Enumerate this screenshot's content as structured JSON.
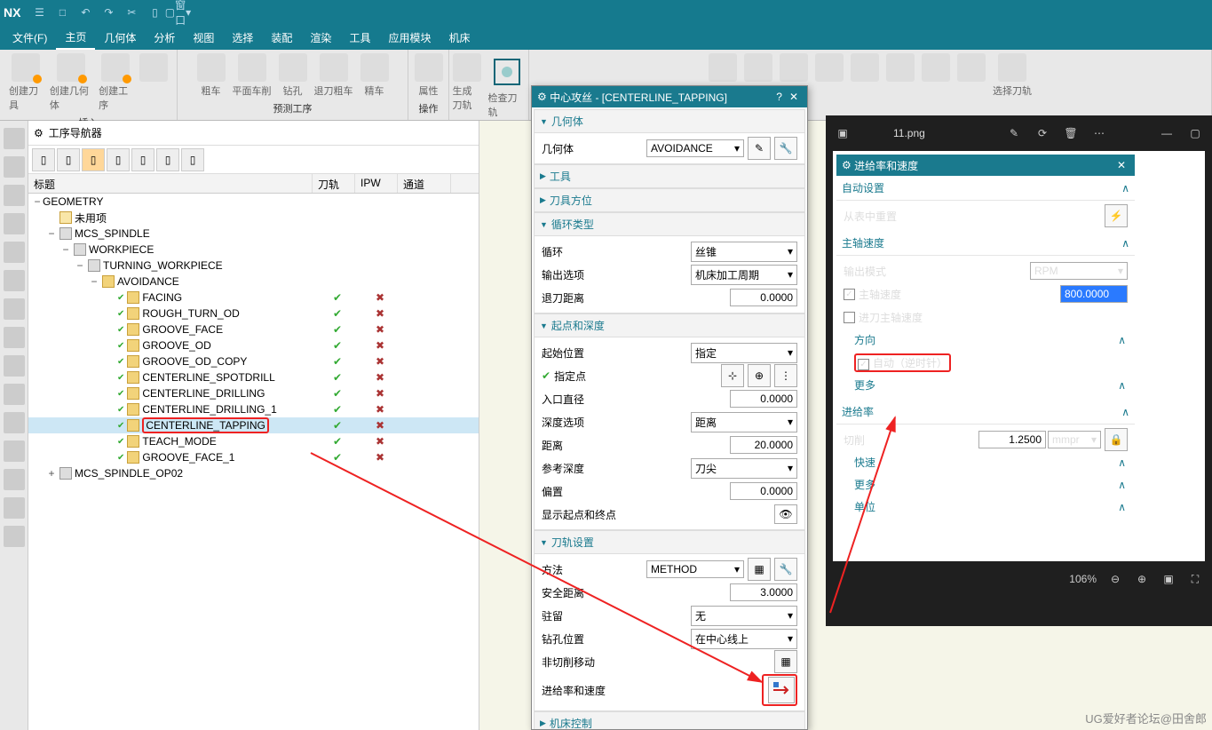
{
  "app": {
    "logo": "NX",
    "window_dropdown": "窗口"
  },
  "menus": {
    "file": "文件(F)",
    "home": "主页",
    "geom": "几何体",
    "analyze": "分析",
    "view": "视图",
    "select": "选择",
    "assemble": "装配",
    "render": "渲染",
    "tools": "工具",
    "appmod": "应用模块",
    "machine": "机床"
  },
  "ribbon": {
    "create_tool": "创建刀具",
    "create_geom": "创建几何体",
    "create_op": "创建工序",
    "rough": "粗车",
    "face": "平面车削",
    "drill": "钻孔",
    "ret_rough": "退刀粗车",
    "finish": "精车",
    "attr": "属性",
    "gen_path": "生成刀轨",
    "verify": "检查刀轨",
    "sel_path": "选择刀轨",
    "insert": "插入",
    "op_group": "预测工序",
    "operate": "操作"
  },
  "nav": {
    "title": "工序导航器",
    "cols": {
      "title": "标题",
      "path": "刀轨",
      "ipw": "IPW",
      "channel": "通道"
    },
    "root": "GEOMETRY",
    "unused": "未用项",
    "mcs": "MCS_SPINDLE",
    "wp": "WORKPIECE",
    "twp": "TURNING_WORKPIECE",
    "avoid": "AVOIDANCE",
    "ops": [
      "FACING",
      "ROUGH_TURN_OD",
      "GROOVE_FACE",
      "GROOVE_OD",
      "GROOVE_OD_COPY",
      "CENTERLINE_SPOTDRILL",
      "CENTERLINE_DRILLING",
      "CENTERLINE_DRILLING_1",
      "CENTERLINE_TAPPING",
      "TEACH_MODE",
      "GROOVE_FACE_1"
    ],
    "mcs2": "MCS_SPINDLE_OP02"
  },
  "dlg1": {
    "title": "中心攻丝 - [CENTERLINE_TAPPING]",
    "geom_hdr": "几何体",
    "geom_lbl": "几何体",
    "geom_val": "AVOIDANCE",
    "tool_hdr": "工具",
    "orient_hdr": "刀具方位",
    "cycle_hdr": "循环类型",
    "cycle_lbl": "循环",
    "cycle_val": "丝锥",
    "output_lbl": "输出选项",
    "output_val": "机床加工周期",
    "retract_lbl": "退刀距离",
    "retract_val": "0.0000",
    "start_hdr": "起点和深度",
    "start_pos_lbl": "起始位置",
    "start_pos_val": "指定",
    "spec_pt": "指定点",
    "entry_d": "入口直径",
    "entry_d_val": "0.0000",
    "depth_opt": "深度选项",
    "depth_opt_val": "距离",
    "dist": "距离",
    "dist_val": "20.0000",
    "ref_depth": "参考深度",
    "ref_depth_val": "刀尖",
    "offset": "偏置",
    "offset_val": "0.0000",
    "show_pts": "显示起点和终点",
    "path_hdr": "刀轨设置",
    "method": "方法",
    "method_val": "METHOD",
    "safe_dist": "安全距离",
    "safe_dist_val": "3.0000",
    "dwell": "驻留",
    "dwell_val": "无",
    "drill_pos": "钻孔位置",
    "drill_pos_val": "在中心线上",
    "noncut": "非切削移动",
    "feed_speed": "进给率和速度",
    "mc_ctrl": "机床控制"
  },
  "photos": {
    "filename": "11.png",
    "zoom": "106%"
  },
  "dlg2": {
    "title": "进给率和速度",
    "auto_hdr": "自动设置",
    "reset": "从表中重置",
    "spindle_hdr": "主轴速度",
    "out_mode": "输出模式",
    "out_mode_val": "RPM",
    "sp_speed": "主轴速度",
    "sp_speed_val": "800.0000",
    "feed_sp": "进刀主轴速度",
    "dir_hdr": "方向",
    "auto_ccw": "自动（逆时针）",
    "more": "更多",
    "feed_hdr": "进给率",
    "cut": "切削",
    "cut_val": "1.2500",
    "cut_unit": "mmpr",
    "rapid": "快速",
    "unit": "单位"
  },
  "watermark": "UG爱好者论坛@田舍郎"
}
